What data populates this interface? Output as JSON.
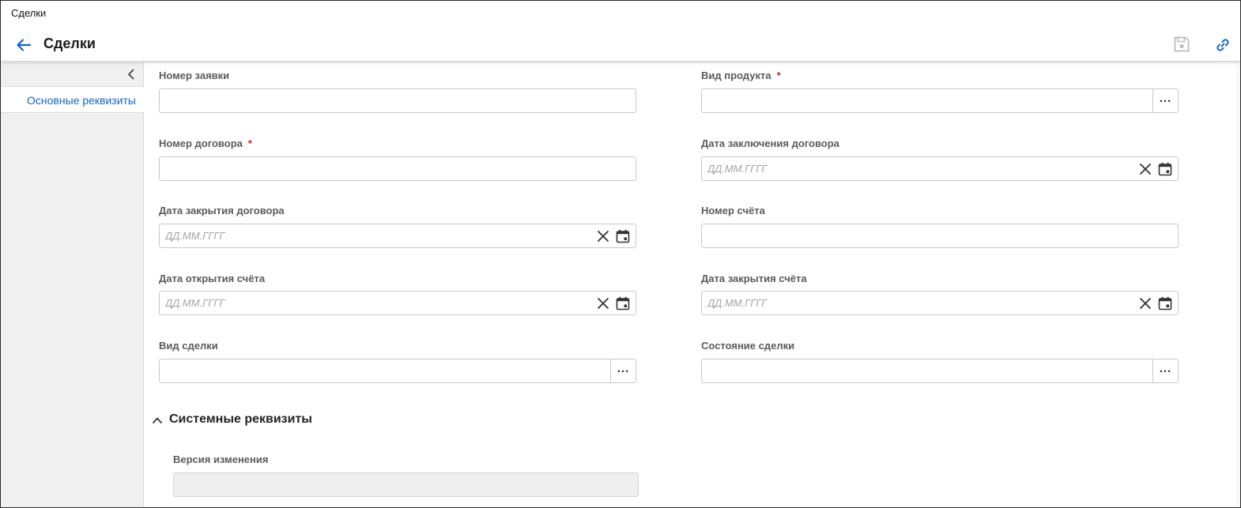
{
  "window": {
    "title": "Сделки"
  },
  "header": {
    "title": "Сделки"
  },
  "sidebar": {
    "items": [
      {
        "label": "Основные реквизиты",
        "active": true
      }
    ]
  },
  "form": {
    "date_placeholder": "ДД.ММ.ГГГГ",
    "application_number": {
      "label": "Номер заявки",
      "value": ""
    },
    "product_type": {
      "label": "Вид продукта",
      "required_mark": "*",
      "value": ""
    },
    "contract_number": {
      "label": "Номер договора",
      "required_mark": "*",
      "value": ""
    },
    "contract_conclusion_date": {
      "label": "Дата заключения договора",
      "value": ""
    },
    "contract_close_date": {
      "label": "Дата закрытия договора",
      "value": ""
    },
    "account_number": {
      "label": "Номер счёта",
      "value": ""
    },
    "account_open_date": {
      "label": "Дата открытия счёта",
      "value": ""
    },
    "account_close_date": {
      "label": "Дата закрытия счёта",
      "value": ""
    },
    "deal_type": {
      "label": "Вид сделки",
      "value": ""
    },
    "deal_state": {
      "label": "Состояние сделки",
      "value": ""
    }
  },
  "system_section": {
    "title": "Системные реквизиты",
    "expanded": true,
    "change_version": {
      "label": "Версия изменения",
      "value": ""
    }
  },
  "colors": {
    "accent": "#1565c0",
    "required": "#c62828",
    "label": "#5b5b5b",
    "border": "#c9c9c9",
    "sidebar_bg": "#f0f0f0"
  },
  "icons": {
    "back": "arrow-left-icon",
    "save": "floppy-disk-icon",
    "link": "chain-link-icon",
    "collapse": "chevron-left-icon",
    "clear": "close-x-icon",
    "calendar": "calendar-icon",
    "lookup": "ellipsis-icon",
    "section_toggle": "chevron-up-icon"
  }
}
